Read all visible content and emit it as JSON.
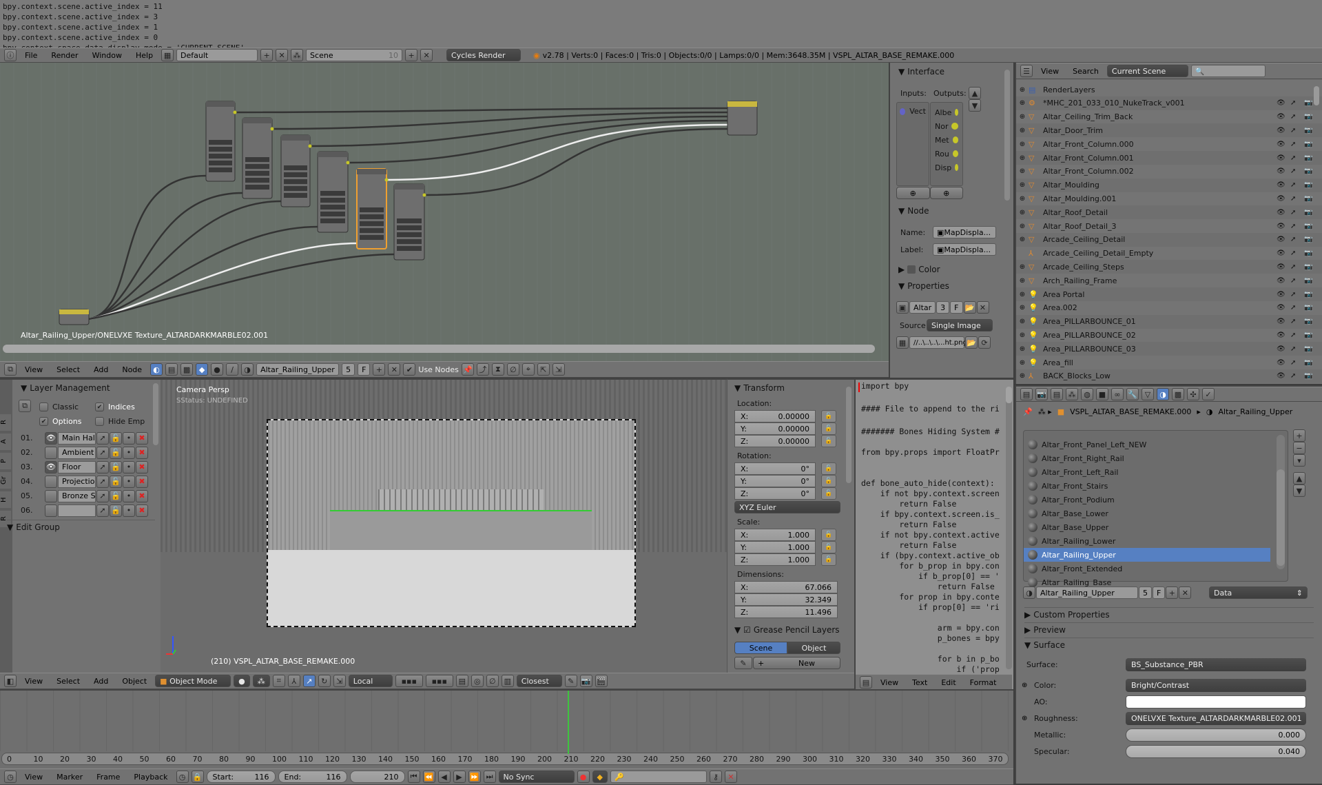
{
  "console": {
    "lines": [
      "bpy.context.scene.active_index = 11",
      "bpy.context.scene.active_index = 3",
      "bpy.context.scene.active_index = 1",
      "bpy.context.scene.active_index = 0",
      "bpy.context.space_data.display_mode = 'CURRENT_SCENE'"
    ]
  },
  "topbar": {
    "menus": [
      "File",
      "Render",
      "Window",
      "Help"
    ],
    "layout": "Default",
    "scene": "Scene",
    "scene_users": "10",
    "engine": "Cycles Render",
    "stats": "v2.78 | Verts:0 | Faces:0 | Tris:0 | Objects:0/0 | Lamps:0/0 | Mem:3648.35M | VSPL_ALTAR_BASE_REMAKE.000"
  },
  "node_editor": {
    "path_label": "Altar_Railing_Upper/ONELVXE Texture_ALTARDARKMARBLE02.001",
    "header": {
      "menus": [
        "View",
        "Select",
        "Add",
        "Node"
      ],
      "material": "Altar_Railing_Upper",
      "users": "5",
      "fake": "F",
      "use_nodes": "Use Nodes",
      "use_nodes_checked": true
    },
    "sidebar": {
      "interface": "Interface",
      "inputs": "Inputs:",
      "outputs": "Outputs:",
      "input_items": [
        "Vect"
      ],
      "output_items": [
        "Albe",
        "Nor",
        "Met",
        "Rou",
        "Disp"
      ],
      "node": "Node",
      "name_label": "Name:",
      "name_value": "MapDispla...",
      "label_label": "Label:",
      "label_value": "MapDispla...",
      "color": "Color",
      "properties": "Properties",
      "image_name": "Altar",
      "image_users": "3",
      "image_fake": "F",
      "source_label": "Source:",
      "source_value": "Single Image",
      "filepath": "//..\\..\\..\\...ht.png"
    }
  },
  "outliner": {
    "menus": [
      "View",
      "Search"
    ],
    "display_mode": "Current Scene",
    "rows": [
      {
        "name": "RenderLayers",
        "type": "renderlayers"
      },
      {
        "name": "*MHC_201_033_010_NukeTrack_v001",
        "type": "scene"
      },
      {
        "name": "Altar_Ceiling_Trim_Back",
        "type": "mesh"
      },
      {
        "name": "Altar_Door_Trim",
        "type": "mesh"
      },
      {
        "name": "Altar_Front_Column.000",
        "type": "mesh"
      },
      {
        "name": "Altar_Front_Column.001",
        "type": "mesh"
      },
      {
        "name": "Altar_Front_Column.002",
        "type": "mesh"
      },
      {
        "name": "Altar_Moulding",
        "type": "mesh"
      },
      {
        "name": "Altar_Moulding.001",
        "type": "mesh"
      },
      {
        "name": "Altar_Roof_Detail",
        "type": "mesh"
      },
      {
        "name": "Altar_Roof_Detail_3",
        "type": "mesh"
      },
      {
        "name": "Arcade_Ceiling_Detail",
        "type": "mesh"
      },
      {
        "name": "Arcade_Ceiling_Detail_Empty",
        "type": "empty"
      },
      {
        "name": "Arcade_Ceiling_Steps",
        "type": "mesh"
      },
      {
        "name": "Arch_Railing_Frame",
        "type": "mesh"
      },
      {
        "name": "Area Portal",
        "type": "lamp"
      },
      {
        "name": "Area.002",
        "type": "lamp"
      },
      {
        "name": "Area_PILLARBOUNCE_01",
        "type": "lamp"
      },
      {
        "name": "Area_PILLARBOUNCE_02",
        "type": "lamp"
      },
      {
        "name": "Area_PILLARBOUNCE_03",
        "type": "lamp"
      },
      {
        "name": "Area_fill",
        "type": "lamp"
      },
      {
        "name": "BACK_Blocks_Low",
        "type": "empty"
      }
    ]
  },
  "properties": {
    "breadcrumb": [
      "VSPL_ALTAR_BASE_REMAKE.000",
      "Altar_Railing_Upper"
    ],
    "materials": [
      "Altar_Front_Panel_Left_NEW",
      "Altar_Front_Right_Rail",
      "Altar_Front_Left_Rail",
      "Altar_Front_Stairs",
      "Altar_Front_Podium",
      "Altar_Base_Lower",
      "Altar_Base_Upper",
      "Altar_Railing_Lower",
      "Altar_Railing_Upper",
      "Altar_Front_Extended",
      "Altar_Railing_Base"
    ],
    "selected_material": "Altar_Railing_Upper",
    "datablock": "Altar_Railing_Upper",
    "users": "5",
    "fake": "F",
    "link": "Data",
    "panels": {
      "custom": "Custom Properties",
      "preview": "Preview",
      "surface": "Surface"
    },
    "surface": [
      {
        "label": "Surface:",
        "value": "BS_Substance_PBR",
        "kind": "node"
      },
      {
        "label": "Color:",
        "value": "Bright/Contrast",
        "kind": "node"
      },
      {
        "label": "AO:",
        "value": "",
        "kind": "color",
        "color": "#ffffff"
      },
      {
        "label": "Roughness:",
        "value": "ONELVXE Texture_ALTARDARKMARBLE02.001",
        "kind": "node"
      },
      {
        "label": "Metallic:",
        "value": "0.000",
        "kind": "slider"
      },
      {
        "label": "Specular:",
        "value": "0.040",
        "kind": "slider"
      }
    ]
  },
  "toolshelf": {
    "tabs": [
      "R",
      "A",
      "P",
      "Gr",
      "H",
      "R"
    ],
    "title": "Layer Management",
    "classic": "Classic",
    "classic_checked": false,
    "indices": "Indices",
    "indices_checked": true,
    "options": "Options",
    "options_checked": true,
    "hide_empty": "Hide Emp",
    "hide_empty_checked": false,
    "layers": [
      {
        "idx": "01.",
        "name": "Main Hal",
        "visible": true
      },
      {
        "idx": "02.",
        "name": "Ambient",
        "visible": false
      },
      {
        "idx": "03.",
        "name": "Floor",
        "visible": true
      },
      {
        "idx": "04.",
        "name": "Projectio",
        "visible": false
      },
      {
        "idx": "05.",
        "name": "Bronze S",
        "visible": false
      },
      {
        "idx": "06.",
        "name": "",
        "visible": false
      }
    ],
    "edit_group": "Edit Group"
  },
  "viewport": {
    "view_name": "Camera Persp",
    "status": "SStatus: UNDEFINED",
    "object_info": "(210) VSPL_ALTAR_BASE_REMAKE.000",
    "header": {
      "menus": [
        "View",
        "Select",
        "Add",
        "Object"
      ],
      "mode": "Object Mode",
      "orientation": "Local",
      "snap": "Closest"
    }
  },
  "transform": {
    "title": "Transform",
    "location": "Location:",
    "loc": [
      "0.00000",
      "0.00000",
      "0.00000"
    ],
    "rotation": "Rotation:",
    "rot": [
      "0°",
      "0°",
      "0°"
    ],
    "rot_mode": "XYZ Euler",
    "scale": "Scale:",
    "scl": [
      "1.000",
      "1.000",
      "1.000"
    ],
    "dimensions": "Dimensions:",
    "dim": [
      "67.066",
      "32.349",
      "11.496"
    ],
    "axes": [
      "X:",
      "Y:",
      "Z:"
    ],
    "grease": "Grease Pencil Layers",
    "gp_scene": "Scene",
    "gp_object": "Object",
    "gp_new": "New"
  },
  "text_editor": {
    "lines": [
      "import bpy",
      "",
      "#### File to append to the ri",
      "",
      "####### Bones Hiding System #",
      "",
      "from bpy.props import FloatPr",
      "",
      "",
      "def bone_auto_hide(context):",
      "    if not bpy.context.screen",
      "        return False",
      "    if bpy.context.screen.is_",
      "        return False",
      "    if not bpy.context.active",
      "        return False",
      "    if (bpy.context.active_ob",
      "        for b_prop in bpy.con",
      "            if b_prop[0] == '",
      "                return False",
      "        for prop in bpy.conte",
      "            if prop[0] == 'ri",
      "",
      "                arm = bpy.con",
      "                p_bones = bpy",
      "",
      "                for b in p_bo",
      "                    if ('prop"
    ],
    "menus": [
      "View",
      "Text",
      "Edit",
      "Format"
    ]
  },
  "timeline": {
    "ticks": [
      0,
      10,
      20,
      30,
      40,
      50,
      60,
      70,
      80,
      90,
      100,
      110,
      120,
      130,
      140,
      150,
      160,
      170,
      180,
      190,
      200,
      210,
      220,
      230,
      240,
      250,
      260,
      270,
      280,
      290,
      300,
      310,
      320,
      330,
      340,
      350,
      360,
      370
    ],
    "current_frame": 210,
    "menus": [
      "View",
      "Marker",
      "Frame",
      "Playback"
    ],
    "start_label": "Start:",
    "start": "116",
    "end_label": "End:",
    "end": "116",
    "frame": "210",
    "sync": "No Sync"
  }
}
